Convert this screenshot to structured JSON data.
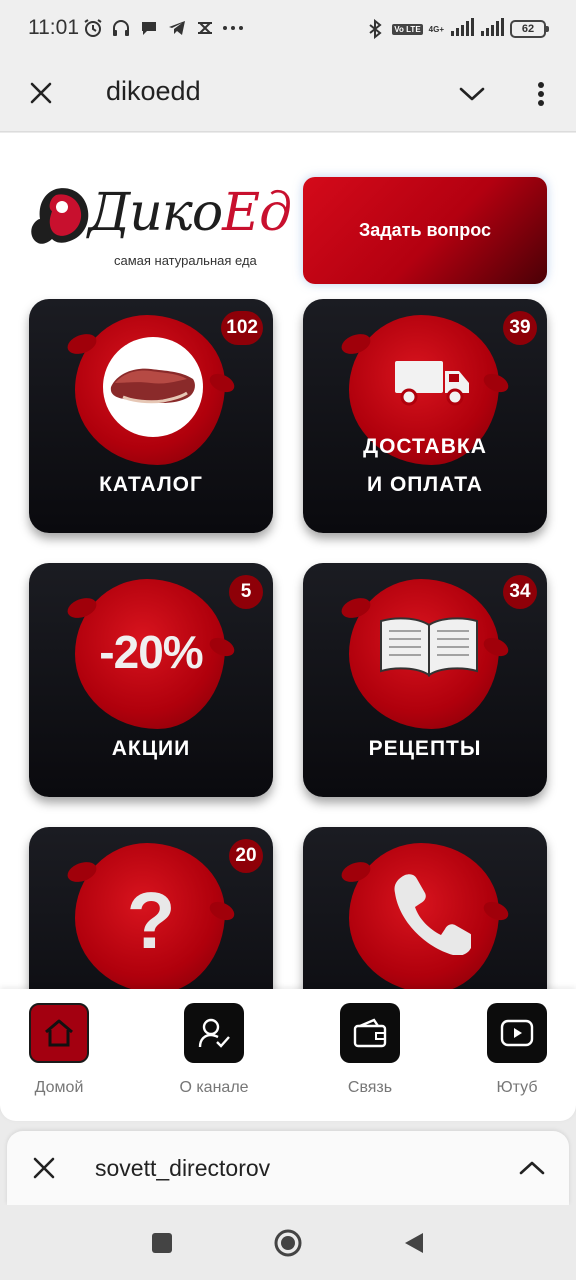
{
  "status_bar": {
    "time": "11:01",
    "net_label": "4G+",
    "volte_label": "Vo LTE",
    "battery": "62",
    "left_icons": [
      "alarm-icon",
      "headphones-icon",
      "chat-icon",
      "telegram-icon",
      "app-icon",
      "more-dots-icon"
    ],
    "right_icons": [
      "bluetooth-icon",
      "volte-icon",
      "signal-icon",
      "signal-icon",
      "battery-icon"
    ]
  },
  "header": {
    "title": "dikoedd",
    "close_icon": "close-icon",
    "chevron_icon": "chevron-down-icon",
    "menu_icon": "more-vert-icon"
  },
  "brand": {
    "logo_text_main": "Дико",
    "logo_text_accent": "Ед",
    "logo_tagline": "самая натуральная еда"
  },
  "ask_button": {
    "label": "Задать вопрос"
  },
  "tiles": [
    {
      "id": "catalog",
      "label_line1": "КАТАЛОГ",
      "label_line2": "",
      "badge": "102",
      "icon": "meat-icon"
    },
    {
      "id": "delivery",
      "label_line1": "ДОСТАВКА",
      "label_line2": "И ОПЛАТА",
      "badge": "39",
      "icon": "truck-icon"
    },
    {
      "id": "promos",
      "label_line1": "АКЦИИ",
      "label_line2": "",
      "badge": "5",
      "icon_text": "-20%",
      "icon": "discount-icon"
    },
    {
      "id": "recipes",
      "label_line1": "РЕЦЕПТЫ",
      "label_line2": "",
      "badge": "34",
      "icon": "book-icon"
    },
    {
      "id": "faq",
      "label_line1": "",
      "label_line2": "",
      "badge": "20",
      "icon_text": "?",
      "icon": "question-icon"
    },
    {
      "id": "contact",
      "label_line1": "",
      "label_line2": "",
      "badge": "",
      "icon": "phone-icon"
    }
  ],
  "bottom_nav": [
    {
      "label": "Домой",
      "icon": "home-icon",
      "active": true
    },
    {
      "label": "О канале",
      "icon": "user-check-icon",
      "active": false
    },
    {
      "label": "Связь",
      "icon": "wallet-icon",
      "active": false
    },
    {
      "label": "Ютуб",
      "icon": "play-icon",
      "active": false
    }
  ],
  "sheet": {
    "title": "sovett_directorov",
    "close_icon": "close-icon",
    "chevron_icon": "chevron-up-icon"
  },
  "system_nav": [
    "square-icon",
    "circle-icon",
    "back-triangle-icon"
  ],
  "colors": {
    "accent": "#c8102e",
    "tile_bg": "#0f1014",
    "badge_bg": "#8e0008"
  }
}
